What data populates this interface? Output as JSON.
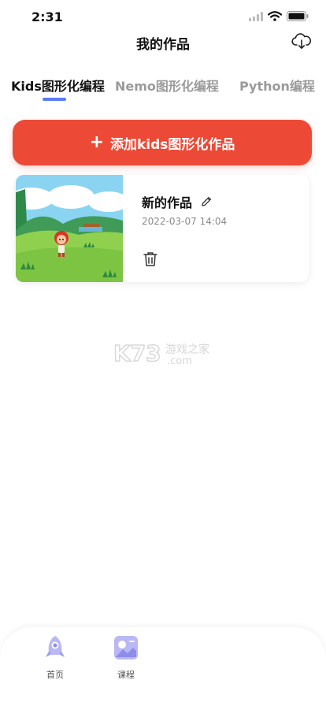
{
  "status_bar": {
    "time": "2:31"
  },
  "nav": {
    "title": "我的作品",
    "cloud_icon": "cloud-download-icon"
  },
  "tabs": [
    {
      "label": "Kids图形化编程",
      "active": true
    },
    {
      "label": "Nemo图形化编程",
      "active": false
    },
    {
      "label": "Python编程",
      "active": false
    }
  ],
  "add_button": {
    "label": "添加kids图形化作品",
    "color": "#ec4a36"
  },
  "works": [
    {
      "title": "新的作品",
      "date": "2022-03-07 14:04",
      "edit_icon": "pencil-icon",
      "delete_icon": "trash-icon"
    }
  ],
  "watermark": {
    "text": "K73",
    "sub": "游戏之家",
    "domain": ".com"
  },
  "bottom_nav": [
    {
      "label": "首页",
      "icon": "rocket-icon"
    },
    {
      "label": "课程",
      "icon": "course-icon"
    }
  ],
  "colors": {
    "accent": "#5a7cf0",
    "primary": "#ec4a36"
  }
}
